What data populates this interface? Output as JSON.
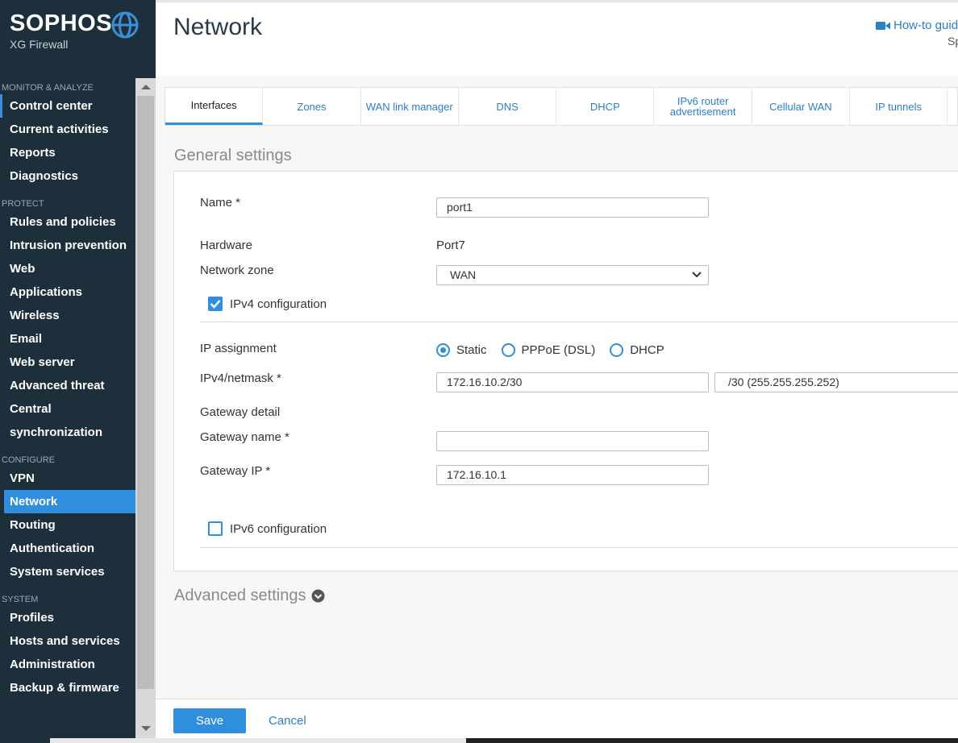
{
  "brand": {
    "name": "SOPHOS",
    "product": "XG Firewall"
  },
  "sidebar": {
    "sections": [
      {
        "title": "MONITOR & ANALYZE",
        "items": [
          "Control center",
          "Current activities",
          "Reports",
          "Diagnostics"
        ]
      },
      {
        "title": "PROTECT",
        "items": [
          "Rules and policies",
          "Intrusion prevention",
          "Web",
          "Applications",
          "Wireless",
          "Email",
          "Web server",
          "Advanced threat",
          "Central",
          "synchronization"
        ]
      },
      {
        "title": "CONFIGURE",
        "items": [
          "VPN",
          "Network",
          "Routing",
          "Authentication",
          "System services"
        ]
      },
      {
        "title": "SYSTEM",
        "items": [
          "Profiles",
          "Hosts and services",
          "Administration",
          "Backup & firmware"
        ]
      }
    ],
    "active_item": "Network"
  },
  "header": {
    "title": "Network",
    "howto_label": "How-to guid",
    "right_text": "Sp"
  },
  "tabs": [
    {
      "label": "Interfaces"
    },
    {
      "label": "Zones"
    },
    {
      "label": "WAN link manager"
    },
    {
      "label": "DNS"
    },
    {
      "label": "DHCP"
    },
    {
      "label": "IPv6 router advertisement"
    },
    {
      "label": "Cellular WAN"
    },
    {
      "label": "IP tunnels"
    }
  ],
  "general": {
    "title": "General settings",
    "name_label": "Name *",
    "name_value": "port1",
    "hardware_label": "Hardware",
    "hardware_value": "Port7",
    "zone_label": "Network zone",
    "zone_value": "WAN",
    "ipv4_config_label": "IPv4 configuration",
    "ipv4_config_checked": true,
    "ip_assignment_label": "IP assignment",
    "ip_assignment_options": [
      "Static",
      "PPPoE (DSL)",
      "DHCP"
    ],
    "ip_assignment_selected": "Static",
    "ipv4_netmask_label": "IPv4/netmask *",
    "ipv4_value": "172.16.10.2/30",
    "netmask_value": "/30 (255.255.255.252)",
    "gateway_detail_label": "Gateway detail",
    "gateway_name_label": "Gateway name *",
    "gateway_name_value": "",
    "gateway_ip_label": "Gateway IP *",
    "gateway_ip_value": "172.16.10.1",
    "ipv6_config_label": "IPv6 configuration",
    "ipv6_config_checked": false
  },
  "advanced": {
    "title": "Advanced settings"
  },
  "footer": {
    "save_label": "Save",
    "cancel_label": "Cancel"
  },
  "colors": {
    "sidebar_bg": "#1e2f3c",
    "accent": "#2f8fdc",
    "link": "#2a7fc7"
  },
  "icons": [
    "globe-icon",
    "video-icon",
    "chevron-down-icon",
    "checkmark-icon",
    "chevron-circle-icon"
  ]
}
